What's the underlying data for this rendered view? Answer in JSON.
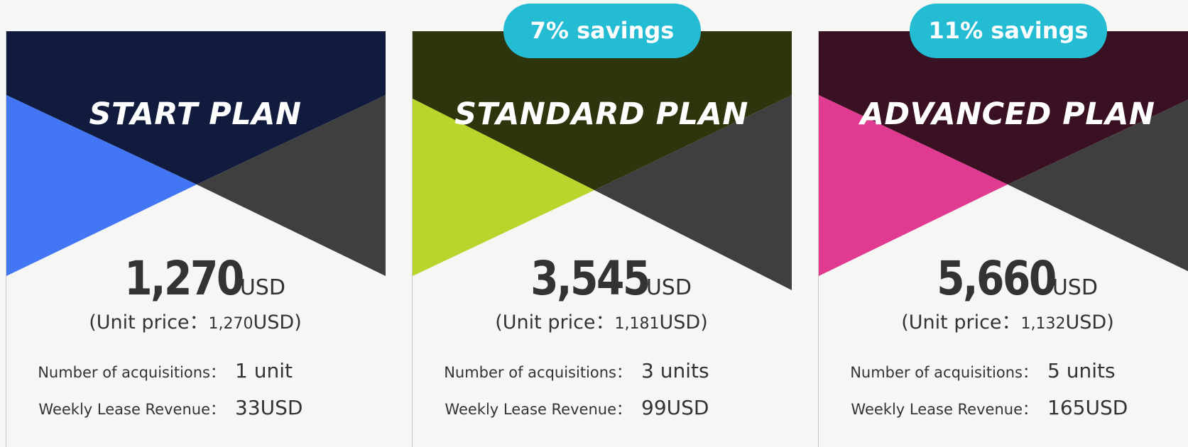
{
  "plans": [
    {
      "title": "START PLAN",
      "price": "1,270",
      "currency": "USD",
      "unit_price_prefix": "(Unit price：",
      "unit_price_value": "1,270",
      "unit_price_suffix": "USD)",
      "acquisitions_label": "Number of acquisitions：",
      "acquisitions_value": "1 unit",
      "revenue_label": "Weekly Lease Revenue：",
      "revenue_value": "33USD",
      "colors": {
        "top": "#101b3d",
        "left": "#4276f4",
        "right": "#3f3f3f"
      }
    },
    {
      "title": "STANDARD PLAN",
      "badge": "7% savings",
      "price": "3,545",
      "currency": "USD",
      "unit_price_prefix": "(Unit price：",
      "unit_price_value": "1,181",
      "unit_price_suffix": "USD)",
      "acquisitions_label": "Number of acquisitions：",
      "acquisitions_value": "3 units",
      "revenue_label": "Weekly Lease Revenue：",
      "revenue_value": "99USD",
      "colors": {
        "top": "#2e340b",
        "left": "#b9d42a",
        "right": "#3f3f3f"
      }
    },
    {
      "title": "ADVANCED PLAN",
      "badge": "11% savings",
      "price": "5,660",
      "currency": "USD",
      "unit_price_prefix": "(Unit price：",
      "unit_price_value": "1,132",
      "unit_price_suffix": "USD)",
      "acquisitions_label": "Number of acquisitions：",
      "acquisitions_value": "5 units",
      "revenue_label": "Weekly Lease Revenue：",
      "revenue_value": "165USD",
      "colors": {
        "top": "#3a1023",
        "left": "#e13a91",
        "right": "#3f3f3f"
      }
    }
  ],
  "badge_color": "#23bcd3"
}
